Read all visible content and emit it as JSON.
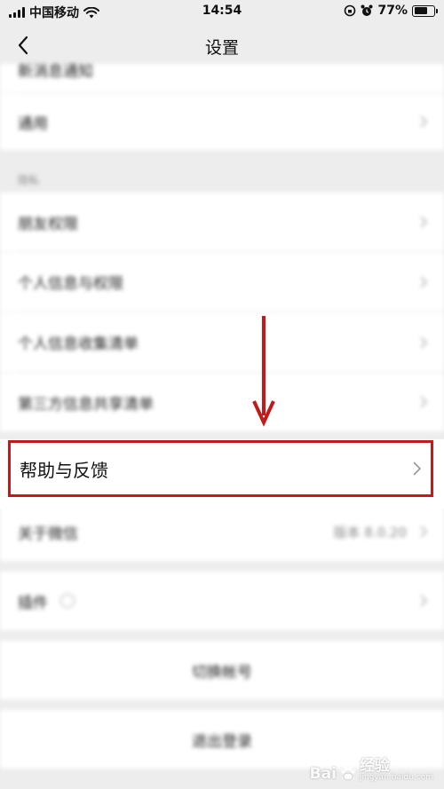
{
  "status_bar": {
    "carrier": "中国移动",
    "time": "14:54",
    "battery": "77%",
    "battery_level": 0.77
  },
  "nav": {
    "title": "设置"
  },
  "rows": {
    "partial_top": "新消息通知",
    "general": "通用",
    "privacy_section": "隐私",
    "friend_permissions": "朋友权限",
    "personal_info_permissions": "个人信息与权限",
    "personal_info_collection": "个人信息收集清单",
    "third_party_sharing": "第三方信息共享清单",
    "help_feedback": "帮助与反馈",
    "about": "关于微信",
    "about_version": "版本 8.0.20",
    "plugins": "插件"
  },
  "actions": {
    "switch_account": "切换帐号",
    "logout": "退出登录"
  },
  "watermark": {
    "brand": "Bai",
    "brand_cn": "经验",
    "url": "jingyan.baidu.com"
  },
  "colors": {
    "highlight": "#c21a1a",
    "background": "#ededed"
  }
}
